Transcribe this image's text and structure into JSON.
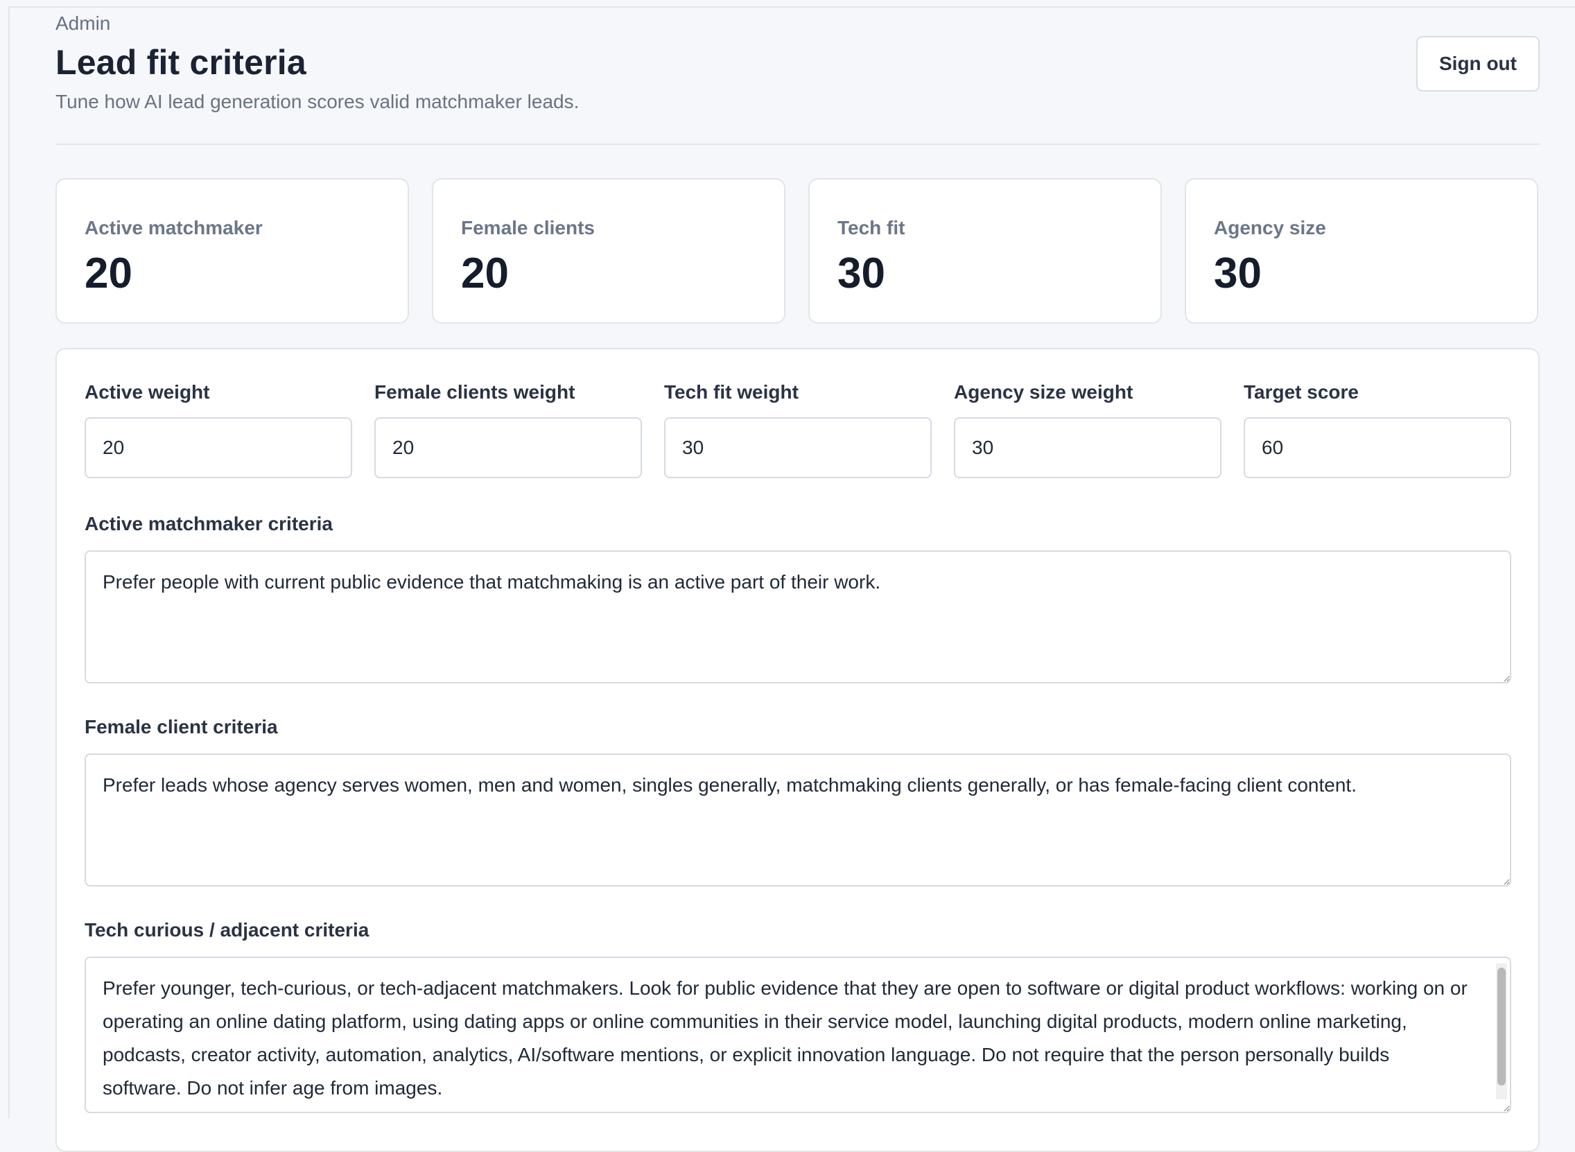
{
  "header": {
    "eyebrow": "Admin",
    "title": "Lead fit criteria",
    "subtitle": "Tune how AI lead generation scores valid matchmaker leads.",
    "sign_out_label": "Sign out"
  },
  "stats": [
    {
      "label": "Active matchmaker",
      "value": "20"
    },
    {
      "label": "Female clients",
      "value": "20"
    },
    {
      "label": "Tech fit",
      "value": "30"
    },
    {
      "label": "Agency size",
      "value": "30"
    }
  ],
  "weights": [
    {
      "label": "Active weight",
      "value": "20"
    },
    {
      "label": "Female clients weight",
      "value": "20"
    },
    {
      "label": "Tech fit weight",
      "value": "30"
    },
    {
      "label": "Agency size weight",
      "value": "30"
    },
    {
      "label": "Target score",
      "value": "60"
    }
  ],
  "criteria": [
    {
      "label": "Active matchmaker criteria",
      "value": "Prefer people with current public evidence that matchmaking is an active part of their work."
    },
    {
      "label": "Female client criteria",
      "value": "Prefer leads whose agency serves women, men and women, singles generally, matchmaking clients generally, or has female-facing client content."
    },
    {
      "label": "Tech curious / adjacent criteria",
      "value": "Prefer younger, tech-curious, or tech-adjacent matchmakers. Look for public evidence that they are open to software or digital product workflows: working on or operating an online dating platform, using dating apps or online communities in their service model, launching digital products, modern online marketing, podcasts, creator activity, automation, analytics, AI/software mentions, or explicit innovation language. Do not require that the person personally builds software. Do not infer age from images."
    }
  ]
}
